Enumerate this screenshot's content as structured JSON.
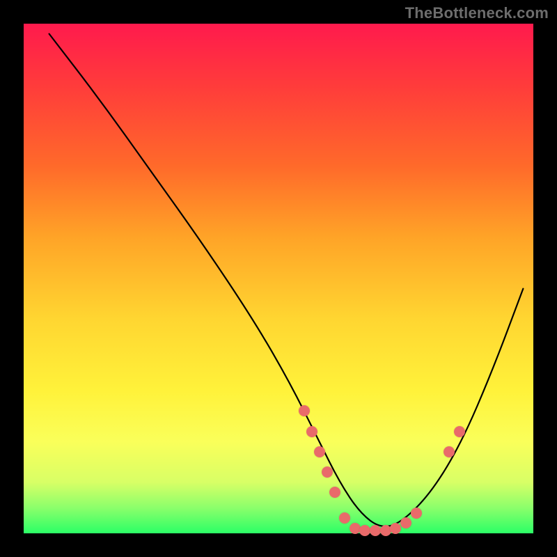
{
  "watermark": "TheBottleneck.com",
  "chart_data": {
    "type": "line",
    "title": "",
    "xlabel": "",
    "ylabel": "",
    "xlim": [
      0,
      100
    ],
    "ylim": [
      0,
      100
    ],
    "grid": false,
    "series": [
      {
        "name": "bottleneck-curve",
        "x": [
          5,
          15,
          25,
          35,
          45,
          52,
          58,
          62,
          66,
          70,
          74,
          80,
          86,
          92,
          98
        ],
        "y": [
          98,
          85,
          71,
          57,
          42,
          30,
          18,
          10,
          4,
          1,
          2,
          8,
          18,
          32,
          48
        ]
      }
    ],
    "points": [
      {
        "name": "pt-left-1",
        "x": 55.0,
        "y": 24
      },
      {
        "name": "pt-left-2",
        "x": 56.5,
        "y": 20
      },
      {
        "name": "pt-left-3",
        "x": 58.0,
        "y": 16
      },
      {
        "name": "pt-left-4",
        "x": 59.5,
        "y": 12
      },
      {
        "name": "pt-left-5",
        "x": 61.0,
        "y": 8
      },
      {
        "name": "pt-bottom-1",
        "x": 63.0,
        "y": 3
      },
      {
        "name": "pt-bottom-2",
        "x": 65.0,
        "y": 1
      },
      {
        "name": "pt-bottom-3",
        "x": 67.0,
        "y": 0.5
      },
      {
        "name": "pt-bottom-4",
        "x": 69.0,
        "y": 0.5
      },
      {
        "name": "pt-bottom-5",
        "x": 71.0,
        "y": 0.5
      },
      {
        "name": "pt-bottom-6",
        "x": 73.0,
        "y": 1
      },
      {
        "name": "pt-bottom-7",
        "x": 75.0,
        "y": 2
      },
      {
        "name": "pt-bottom-8",
        "x": 77.0,
        "y": 4
      },
      {
        "name": "pt-right-1",
        "x": 83.5,
        "y": 16
      },
      {
        "name": "pt-right-2",
        "x": 85.5,
        "y": 20
      }
    ],
    "colors": {
      "curve": "#000000",
      "dot": "#e96a6a",
      "gradient_top": "#ff1a4d",
      "gradient_bottom": "#2bff66"
    }
  }
}
